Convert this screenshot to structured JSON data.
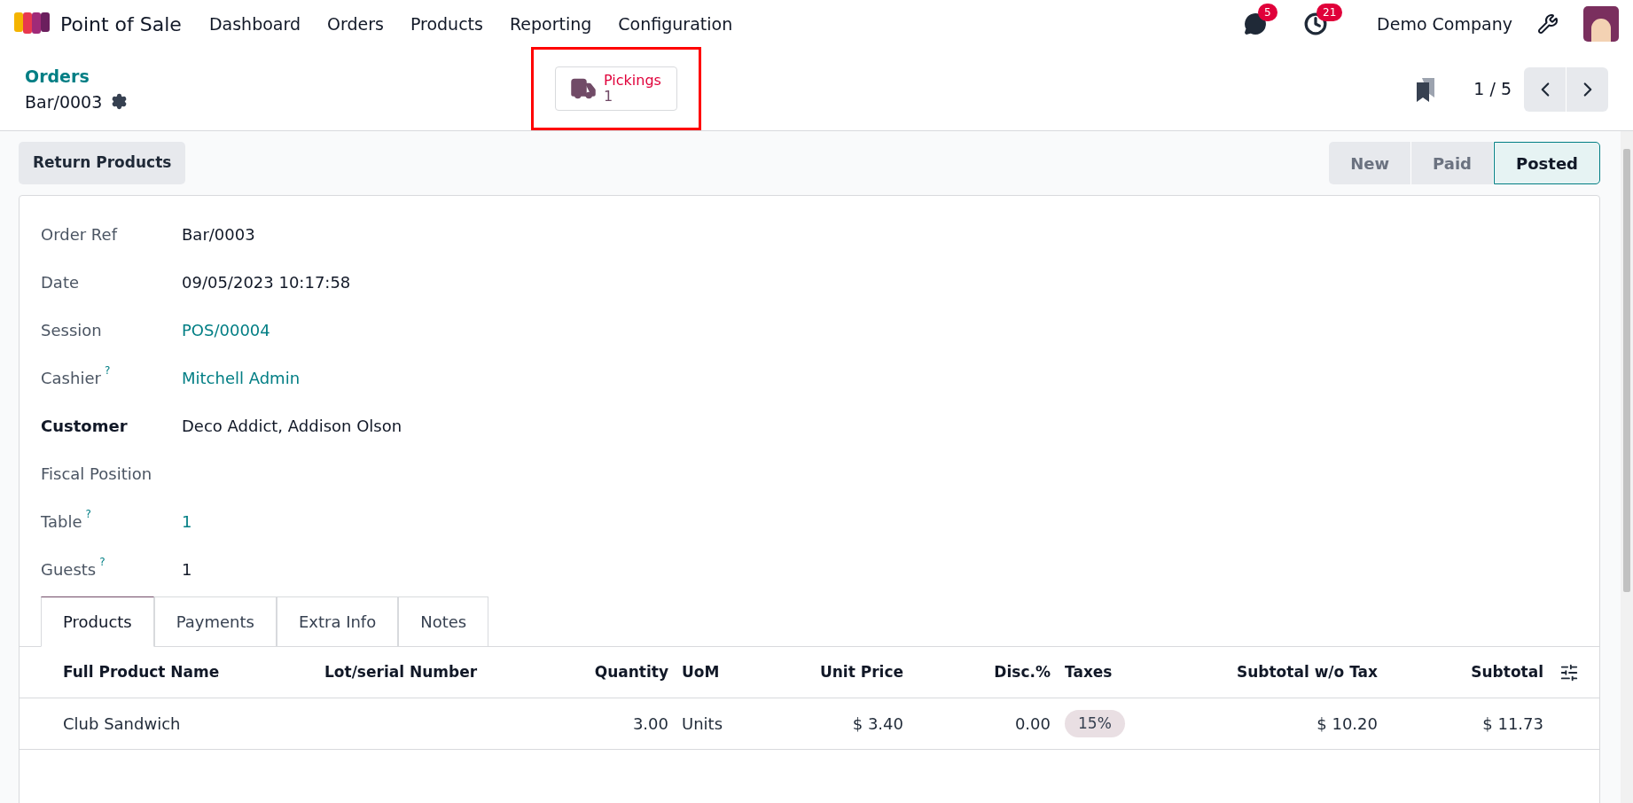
{
  "navbar": {
    "app_name": "Point of Sale",
    "menu": [
      "Dashboard",
      "Orders",
      "Products",
      "Reporting",
      "Configuration"
    ],
    "messages_badge": "5",
    "activities_badge": "21",
    "company": "Demo Company"
  },
  "breadcrumb": {
    "parent": "Orders",
    "current": "Bar/0003"
  },
  "smart_button": {
    "label": "Pickings",
    "count": "1",
    "highlighted": true
  },
  "pager": {
    "value": "1 / 5"
  },
  "action_button": "Return Products",
  "statusbar": [
    {
      "label": "New",
      "selected": false
    },
    {
      "label": "Paid",
      "selected": false
    },
    {
      "label": "Posted",
      "selected": true
    }
  ],
  "fields": [
    {
      "label": "Order Ref",
      "value": "Bar/0003",
      "kind": "text",
      "required": false
    },
    {
      "label": "Date",
      "value": "09/05/2023 10:17:58",
      "kind": "text",
      "required": false
    },
    {
      "label": "Session",
      "value": "POS/00004",
      "kind": "link",
      "required": false
    },
    {
      "label": "Cashier",
      "help": "?",
      "value": "Mitchell Admin",
      "kind": "link",
      "required": false
    },
    {
      "label": "Customer",
      "value": "Deco Addict, Addison Olson",
      "kind": "text",
      "required": true
    },
    {
      "label": "Fiscal Position",
      "required": false
    },
    {
      "label": "Table",
      "help": "?",
      "value": "1",
      "kind": "link",
      "required": false
    },
    {
      "label": "Guests",
      "help": "?",
      "value": "1",
      "kind": "text",
      "required": false
    }
  ],
  "tabs": [
    {
      "label": "Products",
      "selected": true
    },
    {
      "label": "Payments",
      "selected": false
    },
    {
      "label": "Extra Info",
      "selected": false
    },
    {
      "label": "Notes",
      "selected": false
    }
  ],
  "table": {
    "columns": [
      "Full Product Name",
      "Lot/serial Number",
      "Quantity",
      "UoM",
      "Unit Price",
      "Disc.%",
      "Taxes",
      "Subtotal w/o Tax",
      "Subtotal"
    ],
    "rows": [
      {
        "name": "Club Sandwich",
        "quantity": "3.00",
        "uom": "Units",
        "unit_price": "$ 3.40",
        "discount": "0.00",
        "taxes": "15%",
        "subtotal_wo_tax": "$ 10.20",
        "subtotal": "$ 11.73"
      }
    ]
  }
}
